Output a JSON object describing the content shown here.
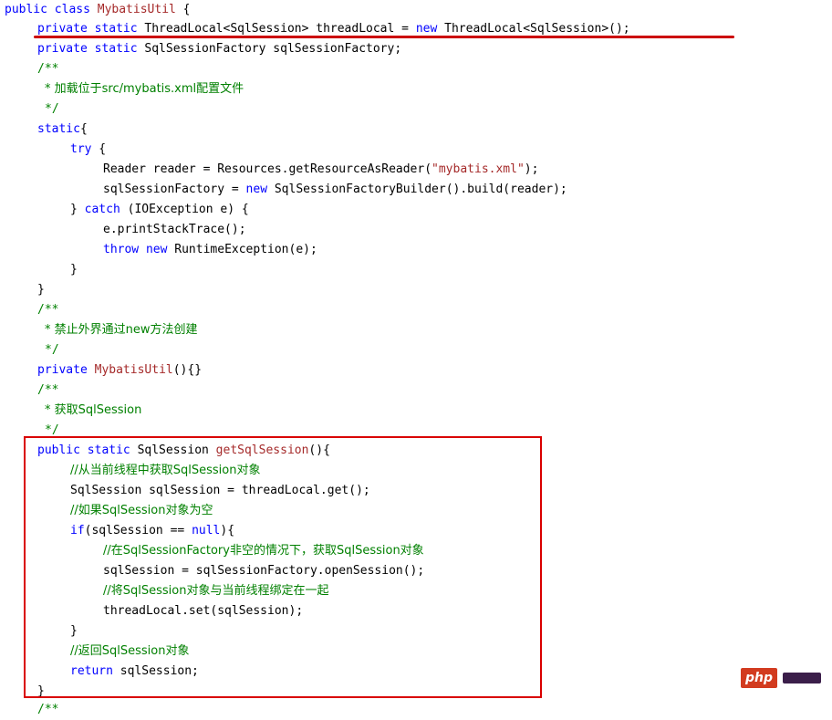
{
  "code": {
    "l1": [
      "public class ",
      "MybatisUtil",
      " {"
    ],
    "l2": [
      "private static",
      " ThreadLocal<SqlSession> threadLocal = ",
      "new",
      " ThreadLocal<SqlSession>();"
    ],
    "l3": [
      "private static",
      " SqlSessionFactory sqlSessionFactory;"
    ],
    "l4": "/**",
    "l5": "* 加载位于src/mybatis.xml配置文件",
    "l6": "*/",
    "l7": [
      "static",
      "{"
    ],
    "l8": [
      "try",
      " {"
    ],
    "l9": [
      "Reader reader = Resources.getResourceAsReader(",
      "\"mybatis.xml\"",
      ");"
    ],
    "l10": [
      "sqlSessionFactory = ",
      "new",
      " SqlSessionFactoryBuilder().build(reader);"
    ],
    "l11": [
      "} ",
      "catch",
      " (IOException e) {"
    ],
    "l12": "e.printStackTrace();",
    "l13": [
      "throw",
      " ",
      "new",
      " RuntimeException(e);"
    ],
    "l14": "}",
    "l15": "}",
    "l16": "/**",
    "l17": "* 禁止外界通过new方法创建",
    "l18": "*/",
    "l19": [
      "private",
      " ",
      "MybatisUtil",
      "(){}"
    ],
    "l20": "/**",
    "l21": "* 获取SqlSession",
    "l22": "*/",
    "l23": [
      "public static",
      " SqlSession ",
      "getSqlSession",
      "(){"
    ],
    "l24": "//从当前线程中获取SqlSession对象",
    "l25": "SqlSession sqlSession = threadLocal.get();",
    "l26": "//如果SqlSession对象为空",
    "l27": [
      "if",
      "(sqlSession == ",
      "null",
      "){"
    ],
    "l28": "//在SqlSessionFactory非空的情况下，获取SqlSession对象",
    "l29": "sqlSession = sqlSessionFactory.openSession();",
    "l30": "//将SqlSession对象与当前线程绑定在一起",
    "l31": "threadLocal.set(sqlSession);",
    "l32": "}",
    "l33": "//返回SqlSession对象",
    "l34": [
      "return",
      " sqlSession;"
    ],
    "l35": "}",
    "l36": "/**"
  },
  "watermark": {
    "logo_text": "php"
  },
  "colors": {
    "keyword": "#0000ff",
    "function_name": "#a52a2a",
    "string": "#a52a2a",
    "comment": "#008000",
    "highlight_box": "#d90000",
    "underline": "#cc0000"
  }
}
